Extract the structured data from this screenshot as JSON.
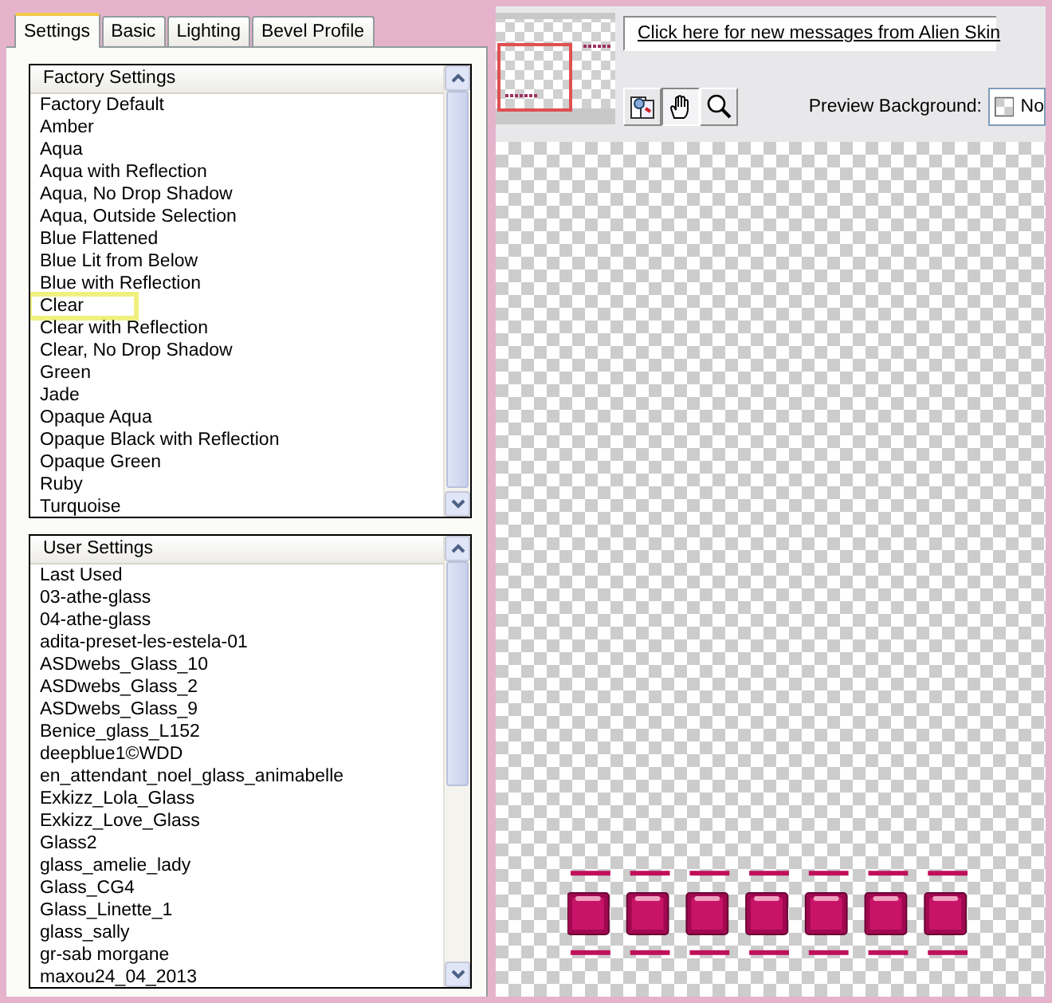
{
  "tabs": [
    {
      "label": "Settings",
      "selected": true
    },
    {
      "label": "Basic",
      "selected": false
    },
    {
      "label": "Lighting",
      "selected": false
    },
    {
      "label": "Bevel Profile",
      "selected": false
    }
  ],
  "factory_list": {
    "header": "Factory Settings",
    "items": [
      {
        "label": "Factory Default",
        "selected": false
      },
      {
        "label": "Amber",
        "selected": false
      },
      {
        "label": "Aqua",
        "selected": false
      },
      {
        "label": "Aqua with Reflection",
        "selected": false
      },
      {
        "label": "Aqua, No Drop Shadow",
        "selected": false
      },
      {
        "label": "Aqua, Outside Selection",
        "selected": false
      },
      {
        "label": "Blue Flattened",
        "selected": false
      },
      {
        "label": "Blue Lit from Below",
        "selected": false
      },
      {
        "label": "Blue with Reflection",
        "selected": false
      },
      {
        "label": "Clear",
        "selected": true
      },
      {
        "label": "Clear with Reflection",
        "selected": false
      },
      {
        "label": "Clear, No Drop Shadow",
        "selected": false
      },
      {
        "label": "Green",
        "selected": false
      },
      {
        "label": "Jade",
        "selected": false
      },
      {
        "label": "Opaque Aqua",
        "selected": false
      },
      {
        "label": "Opaque Black with Reflection",
        "selected": false
      },
      {
        "label": "Opaque Green",
        "selected": false
      },
      {
        "label": "Ruby",
        "selected": false
      },
      {
        "label": "Turquoise",
        "selected": false
      }
    ]
  },
  "user_list": {
    "header": "User Settings",
    "items": [
      {
        "label": "Last Used",
        "selected": false
      },
      {
        "label": "03-athe-glass",
        "selected": false
      },
      {
        "label": "04-athe-glass",
        "selected": false
      },
      {
        "label": "adita-preset-les-estela-01",
        "selected": false
      },
      {
        "label": "ASDwebs_Glass_10",
        "selected": false
      },
      {
        "label": "ASDwebs_Glass_2",
        "selected": false
      },
      {
        "label": "ASDwebs_Glass_9",
        "selected": false
      },
      {
        "label": "Benice_glass_L152",
        "selected": false
      },
      {
        "label": "deepblue1©WDD",
        "selected": false
      },
      {
        "label": "en_attendant_noel_glass_animabelle",
        "selected": false
      },
      {
        "label": "Exkizz_Lola_Glass",
        "selected": false
      },
      {
        "label": "Exkizz_Love_Glass",
        "selected": false
      },
      {
        "label": "Glass2",
        "selected": false
      },
      {
        "label": "glass_amelie_lady",
        "selected": false
      },
      {
        "label": "Glass_CG4",
        "selected": false
      },
      {
        "label": "Glass_Linette_1",
        "selected": false
      },
      {
        "label": "glass_sally",
        "selected": false
      },
      {
        "label": "gr-sab morgane",
        "selected": false
      },
      {
        "label": "maxou24_04_2013",
        "selected": false
      }
    ]
  },
  "message_link": "Click here for new messages from Alien Skin",
  "tools": [
    {
      "kind": "compare",
      "selected": false
    },
    {
      "kind": "hand",
      "selected": true
    },
    {
      "kind": "zoom",
      "selected": false
    }
  ],
  "preview_background": {
    "label": "Preview Background:",
    "value": "No"
  }
}
